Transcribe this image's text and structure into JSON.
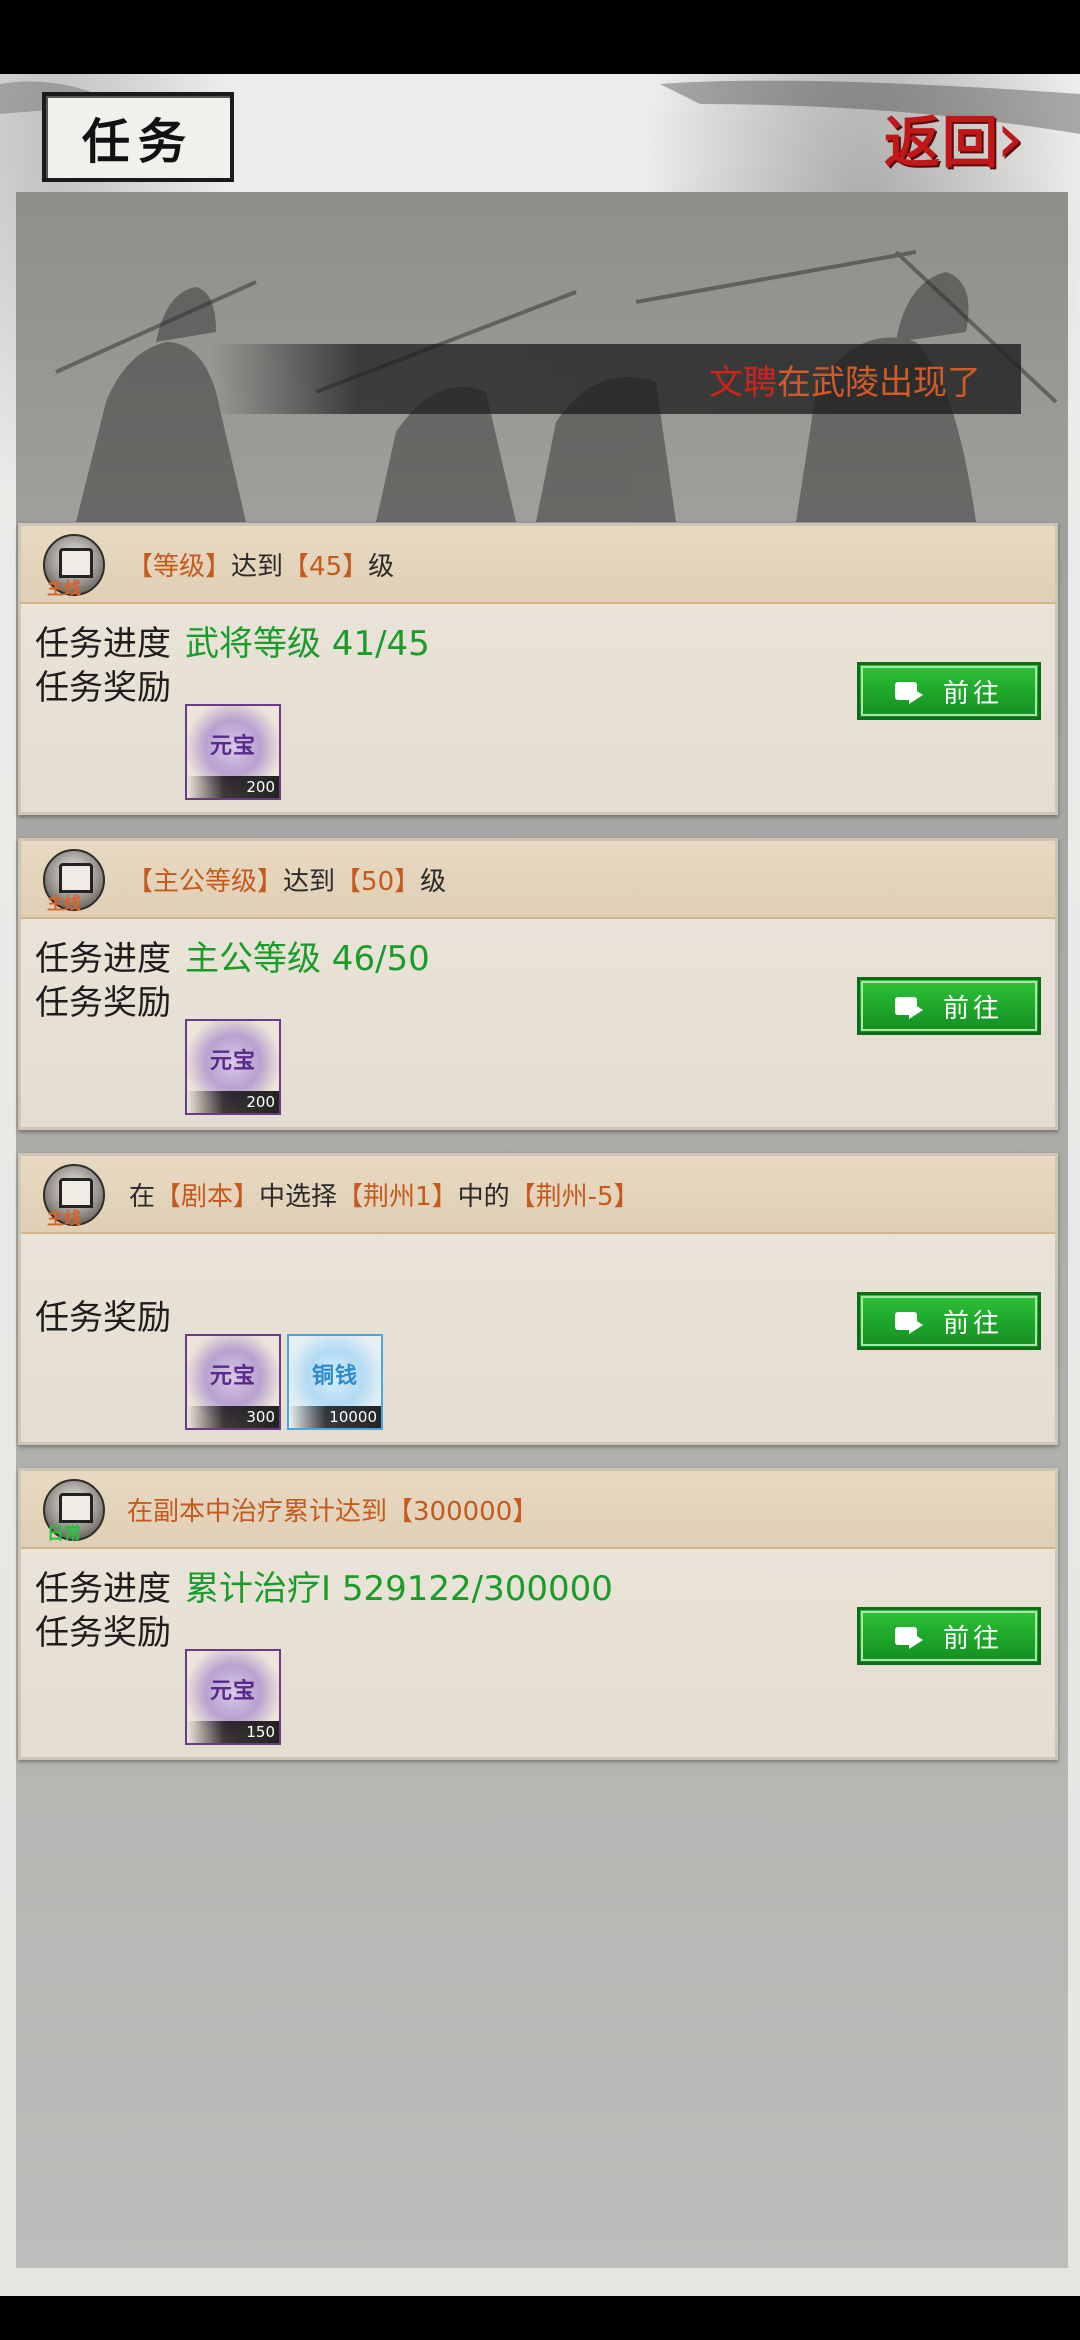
{
  "header": {
    "title": "任务",
    "back_label": "返回"
  },
  "banner": {
    "name": "文聘",
    "message": "在武陵出现了"
  },
  "tasks": [
    {
      "tag": "主线",
      "head": {
        "pre": "",
        "p1": "【等级】",
        "mid1": "达到",
        "p2": "【45】",
        "mid2": "级",
        "p3": "",
        "mid3": "",
        "p4": ""
      },
      "progress_label": "任务进度",
      "progress_value": "武将等级 41/45",
      "reward_label": "任务奖励",
      "rewards": [
        {
          "name": "元宝",
          "qty": "200"
        }
      ],
      "button": "前往"
    },
    {
      "tag": "主线",
      "head": {
        "pre": "",
        "p1": "【主公等级】",
        "mid1": "达到",
        "p2": "【50】",
        "mid2": "级",
        "p3": "",
        "mid3": "",
        "p4": ""
      },
      "progress_label": "任务进度",
      "progress_value": "主公等级 46/50",
      "reward_label": "任务奖励",
      "rewards": [
        {
          "name": "元宝",
          "qty": "200"
        }
      ],
      "button": "前往"
    },
    {
      "tag": "主线",
      "head": {
        "pre": "在",
        "p1": "【剧本】",
        "mid1": "中选择",
        "p2": "【荆州1】",
        "mid2": "中的",
        "p3": "【荆州-5】",
        "mid3": "",
        "p4": ""
      },
      "reward_label": "任务奖励",
      "rewards": [
        {
          "name": "元宝",
          "qty": "300"
        },
        {
          "name": "铜钱",
          "qty": "10000"
        }
      ],
      "button": "前往"
    },
    {
      "tag": "日常",
      "head": {
        "all": "在副本中治疗累计达到【300000】"
      },
      "progress_label": "任务进度",
      "progress_value": "累计治疗I 529122/300000",
      "reward_label": "任务奖励",
      "rewards": [
        {
          "name": "元宝",
          "qty": "150"
        }
      ],
      "button": "前往"
    }
  ]
}
